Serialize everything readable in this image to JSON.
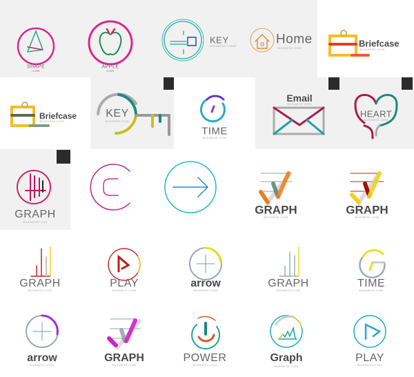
{
  "colors": {
    "background": "#ffffff",
    "tile": "#f1f1f1",
    "text": "#555555",
    "subtext": "#aaaaaa"
  },
  "icons": [
    {
      "id": "shape",
      "icon": "pyramid-icon",
      "label": "SHAPE",
      "sub": "ICON"
    },
    {
      "id": "apple",
      "icon": "apple-icon",
      "label": "APPLE",
      "sub": "ICON"
    },
    {
      "id": "key-stamp",
      "icon": "key-icon",
      "label": "KEY",
      "sub": "BUSINESS STAMP"
    },
    {
      "id": "home",
      "icon": "house-icon",
      "label": "Home",
      "sub": "BUSINESS ICON"
    },
    {
      "id": "briefcase-1",
      "icon": "briefcase-icon",
      "label": "Briefcase",
      "sub": "BUSINESS ICON"
    },
    {
      "id": "briefcase-2",
      "icon": "briefcase-icon",
      "label": "Briefcase",
      "sub": "BUSINESS ICON"
    },
    {
      "id": "key",
      "icon": "key-icon",
      "label": "KEY",
      "sub": "BUSINESS ICON"
    },
    {
      "id": "time-1",
      "icon": "clock-icon",
      "label": "TIME",
      "sub": "BUSINESS ICON"
    },
    {
      "id": "email",
      "icon": "envelope-icon",
      "label": "Email",
      "sub": "BUSINESS ICON"
    },
    {
      "id": "heart",
      "icon": "heart-icon",
      "label": "HEART",
      "sub": "BUSINESS ICON"
    },
    {
      "id": "graph-1",
      "icon": "graph-icon",
      "label": "GRAPH",
      "sub": "BUSINESS ICON"
    },
    {
      "id": "c-letter",
      "icon": "letter-c-icon"
    },
    {
      "id": "arrow-circle",
      "icon": "arrow-right-icon"
    },
    {
      "id": "graph-2",
      "icon": "graph-icon",
      "label": "GRAPH",
      "sub": "BUSINESS ICON"
    },
    {
      "id": "graph-3",
      "icon": "graph-icon",
      "label": "GRAPH",
      "sub": "BUSINESS ICON"
    },
    {
      "id": "graph-4",
      "icon": "bar-chart-icon",
      "label": "GRAPH",
      "sub": "BUSINESS ICON"
    },
    {
      "id": "play-1",
      "icon": "play-icon",
      "label": "PLAY",
      "sub": "BUSINESS ICON"
    },
    {
      "id": "arrow-1",
      "icon": "plus-circle-icon",
      "label": "arrow",
      "sub": "BUSINESS ICON"
    },
    {
      "id": "graph-5",
      "icon": "bar-chart-icon",
      "label": "GRAPH",
      "sub": "BUSINESS ICON"
    },
    {
      "id": "time-2",
      "icon": "clock-icon",
      "label": "TIME",
      "sub": "BUSINESS ICON"
    },
    {
      "id": "arrow-2",
      "icon": "plus-circle-icon",
      "label": "arrow",
      "sub": "BUSINESS ICON"
    },
    {
      "id": "graph-6",
      "icon": "graph-icon",
      "label": "GRAPH",
      "sub": "BUSINESS ICON"
    },
    {
      "id": "power",
      "icon": "power-icon",
      "label": "POWER",
      "sub": "BUSINESS ICON"
    },
    {
      "id": "graph-7",
      "icon": "line-chart-icon",
      "label": "Graph",
      "sub": "BUSINESS ICON"
    },
    {
      "id": "play-2",
      "icon": "play-icon",
      "label": "PLAY",
      "sub": "BUSINESS ICON"
    }
  ]
}
